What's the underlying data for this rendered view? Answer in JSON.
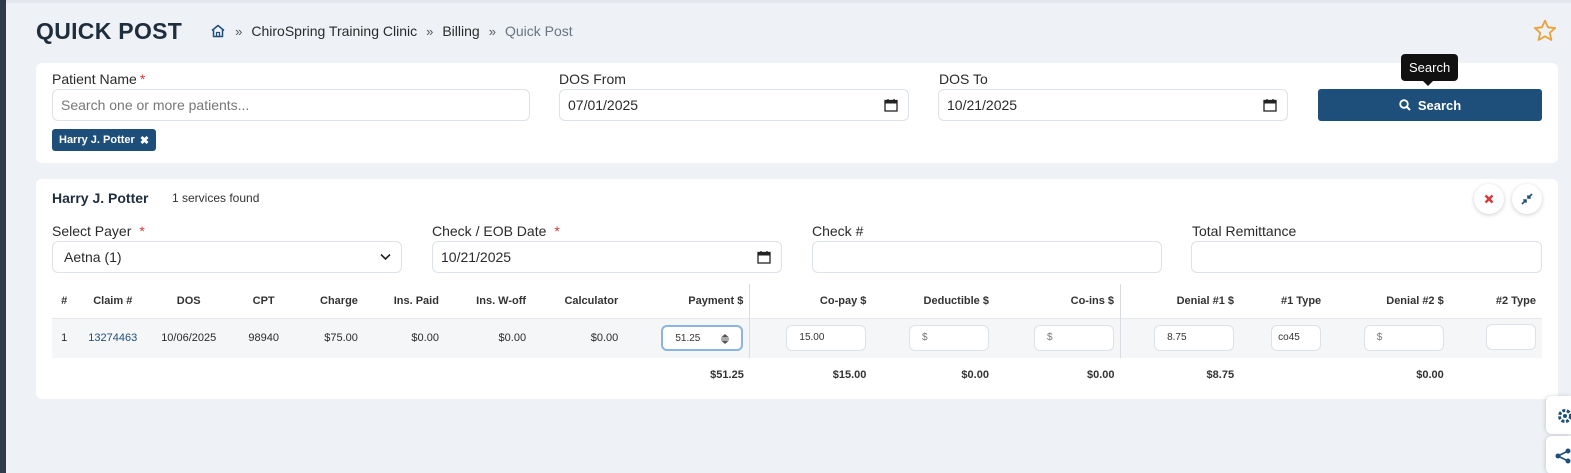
{
  "page": {
    "title": "QUICK POST",
    "breadcrumb": [
      "ChiroSpring Training Clinic",
      "Billing",
      "Quick Post"
    ],
    "breadcrumb_separator": "»"
  },
  "search": {
    "patient_label": "Patient Name",
    "required_mark": "*",
    "patient_placeholder": "Search one or more patients...",
    "dos_from_label": "DOS From",
    "dos_from_value": "07/01/2025",
    "dos_to_label": "DOS To",
    "dos_to_value": "10/21/2025",
    "selected_patient_tag": "Harry J. Potter",
    "tag_remove": "✖",
    "search_button": "Search",
    "tooltip": "Search"
  },
  "result": {
    "patient_name": "Harry J. Potter",
    "services_found": "1 services found",
    "payer_label": "Select Payer",
    "payer_value": "Aetna (1)",
    "check_date_label": "Check / EOB Date",
    "check_date_value": "10/21/2025",
    "check_no_label": "Check #",
    "total_remittance_label": "Total Remittance",
    "columns": [
      "#",
      "Claim #",
      "DOS",
      "CPT",
      "Charge",
      "Ins. Paid",
      "Ins. W-off",
      "Calculator",
      "Payment $",
      "Co-pay $",
      "Deductible $",
      "Co-ins $",
      "Denial #1 $",
      "#1 Type",
      "Denial #2 $",
      "#2 Type"
    ],
    "row": {
      "index": "1",
      "claim": "13274463",
      "dos": "10/06/2025",
      "cpt": "98940",
      "charge": "$75.00",
      "ins_paid": "$0.00",
      "ins_woff": "$0.00",
      "calculator": "$0.00",
      "payment": "51.25",
      "copay": "15.00",
      "deductible_ph": "$",
      "coins_ph": "$",
      "denial1": "8.75",
      "type1": "co45",
      "denial2_ph": "$",
      "type2": ""
    },
    "totals": {
      "payment": "$51.25",
      "copay": "$15.00",
      "deductible": "$0.00",
      "coins": "$0.00",
      "denial1": "$8.75",
      "denial2": "$0.00"
    }
  },
  "colors": {
    "primary": "#1e4f7a",
    "required": "#d9383a",
    "star": "#e8a33d"
  }
}
